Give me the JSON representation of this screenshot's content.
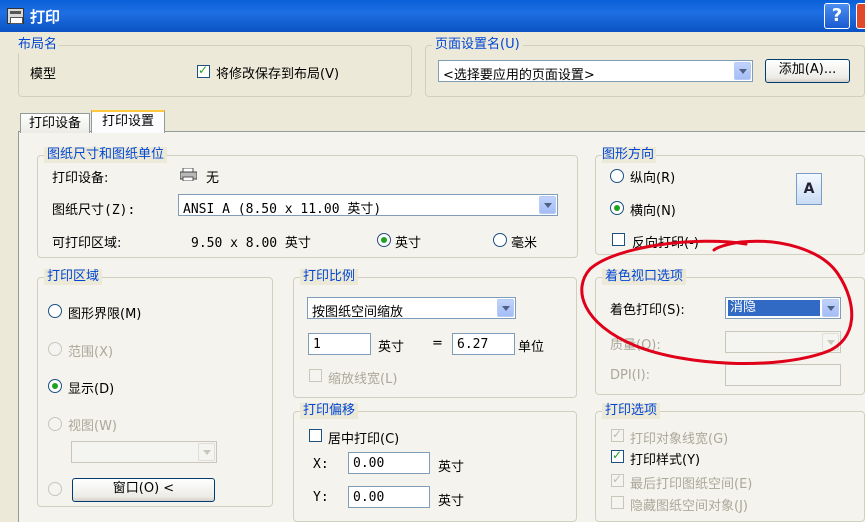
{
  "window": {
    "title": "打印",
    "help_label": "?"
  },
  "layout_name": {
    "legend": "布局名",
    "name": "模型",
    "save_checkbox_label": "将修改保存到布局(V)",
    "save_checked": true
  },
  "page_setup": {
    "legend": "页面设置名(U)",
    "selected": "<选择要应用的页面设置>",
    "add_button": "添加(A)..."
  },
  "tabs": [
    {
      "label": "打印设备",
      "active": false
    },
    {
      "label": "打印设置",
      "active": true
    }
  ],
  "paper": {
    "legend": "图纸尺寸和图纸单位",
    "device_label": "打印设备:",
    "device_value": "无",
    "size_label": "图纸尺寸(Z):",
    "size_value": "ANSI A (8.50 x 11.00 英寸)",
    "printable_label": "可打印区域:",
    "printable_value": "9.50 x 8.00 英寸",
    "unit_inch": "英寸",
    "unit_mm": "毫米",
    "selected_unit": "英寸"
  },
  "orientation": {
    "legend": "图形方向",
    "portrait": "纵向(R)",
    "landscape": "横向(N)",
    "reverse": "反向打印(-)",
    "selected": "landscape",
    "reverse_checked": false,
    "icon_letter": "A",
    "icon": "landscape-page-icon"
  },
  "plot_area": {
    "legend": "打印区域",
    "limits": "图形界限(M)",
    "extents": "范围(X)",
    "display": "显示(D)",
    "view": "视图(W)",
    "window_button": "窗口(O) <",
    "selected": "display"
  },
  "scale": {
    "legend": "打印比例",
    "selected": "按图纸空间缩放",
    "value1": "1",
    "unit1": "英寸",
    "equals": "=",
    "value2": "6.27",
    "unit2": "单位",
    "scale_lineweights": "缩放线宽(L)"
  },
  "offset": {
    "legend": "打印偏移",
    "center": "居中打印(C)",
    "x_label": "X:",
    "x_value": "0.00",
    "y_label": "Y:",
    "y_value": "0.00",
    "unit": "英寸"
  },
  "shaded_viewport": {
    "legend": "着色视口选项",
    "shade_label": "着色打印(S):",
    "shade_value": "消隐",
    "quality_label": "质量(Q):",
    "dpi_label": "DPI(I):"
  },
  "plot_options": {
    "legend": "打印选项",
    "lineweights": "打印对象线宽(G)",
    "plot_styles": "打印样式(Y)",
    "paperspace_last": "最后打印图纸空间(E)",
    "hide_objects": "隐藏图纸空间对象(J)"
  },
  "colors": {
    "title_bar": "#0a5fd8",
    "legend": "#0046d5",
    "highlight": "#316ac5",
    "annotation": "#e0001a"
  }
}
